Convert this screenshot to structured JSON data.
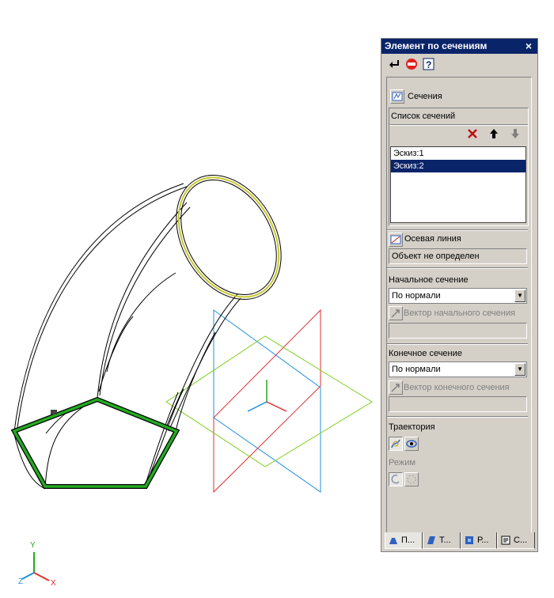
{
  "panel": {
    "title": "Элемент по сечениям",
    "close_glyph": "×",
    "sections_label": "Сечения",
    "sections_list_header": "Список сечений",
    "sections_list": [
      "Эскиз:1",
      "Эскиз:2"
    ],
    "selected_index": 1,
    "axis_label": "Осевая линия",
    "axis_value": "Объект не определен",
    "start_section_label": "Начальное сечение",
    "start_section_value": "По нормали",
    "start_vector_label": "Вектор начального сечения",
    "end_section_label": "Конечное сечение",
    "end_section_value": "По нормали",
    "end_vector_label": "Вектор конечного сечения",
    "trajectory_label": "Траектория",
    "mode_label": "Режим",
    "tabs": [
      "П...",
      "Т...",
      "Р...",
      "С..."
    ],
    "toolbar_icons": [
      "enter-icon",
      "stop-icon",
      "help-icon"
    ]
  },
  "viewport": {
    "axis_labels": {
      "x": "X",
      "y": "Y",
      "z": "Z"
    },
    "colors": {
      "outline": "#000000",
      "profile": "#22aa22",
      "ring": "#c8c830",
      "plane_red": "#e03030",
      "plane_blue": "#2090e0",
      "plane_green": "#80d020"
    }
  }
}
